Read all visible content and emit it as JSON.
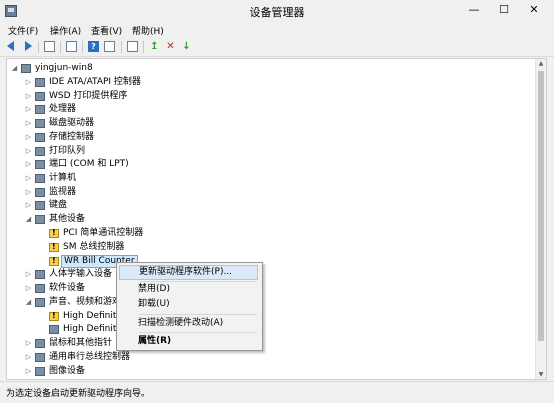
{
  "window": {
    "title": "设备管理器",
    "min": "—",
    "max": "☐",
    "close": "✕"
  },
  "menu": [
    "文件(F)",
    "操作(A)",
    "查看(V)",
    "帮助(H)"
  ],
  "tree": {
    "root": "yingjun-win8",
    "categories": [
      "IDE ATA/ATAPI 控制器",
      "WSD 打印提供程序",
      "处理器",
      "磁盘驱动器",
      "存储控制器",
      "打印队列",
      "端口 (COM 和 LPT)",
      "计算机",
      "监视器",
      "键盘",
      "其他设备",
      "PCI 简单通讯控制器",
      "SM 总线控制器",
      "WR Bill Counter",
      "人体学输入设备",
      "软件设备",
      "声音、视频和游戏",
      "High Definitio",
      "High Definitio",
      "鼠标和其他指针",
      "通用串行总线控制器",
      "图像设备"
    ]
  },
  "context_menu": {
    "update_driver": "更新驱动程序软件(P)...",
    "disable": "禁用(D)",
    "uninstall": "卸载(U)",
    "scan": "扫描检测硬件改动(A)",
    "properties": "属性(R)"
  },
  "status": "为选定设备启动更新驱动程序向导。",
  "colors": {
    "selection": "#cce8ff",
    "highlight": "#dbe9f8",
    "accent": "#2c6fbf"
  }
}
